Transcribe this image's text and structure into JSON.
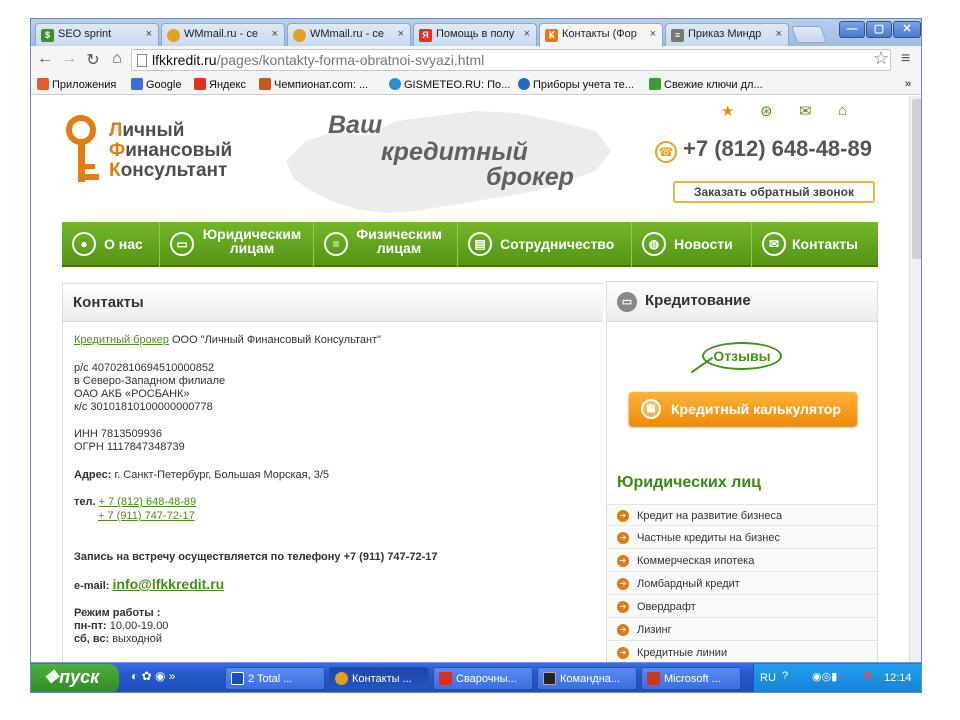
{
  "browser": {
    "tabs": [
      {
        "label": "SEO sprint",
        "icon": "dollar-icon",
        "color": "#3e8f2c",
        "active": false
      },
      {
        "label": "WMmail.ru - се",
        "icon": "coin-icon",
        "color": "#e5a220",
        "active": false
      },
      {
        "label": "WMmail.ru - се",
        "icon": "coin-icon",
        "color": "#e5a220",
        "active": false
      },
      {
        "label": "Помощь в полу",
        "icon": "yandex-icon",
        "color": "#e53020",
        "active": false
      },
      {
        "label": "Контакты (Фор",
        "icon": "key-icon",
        "color": "#e57c12",
        "active": true
      },
      {
        "label": "Приказ Миндр",
        "icon": "document-icon",
        "color": "#777777",
        "active": false
      }
    ],
    "tab_close": "×",
    "window_controls": {
      "minimize": "—",
      "maximize": "▢",
      "close": "✕"
    },
    "url": {
      "host": "lfkkredit.ru",
      "path": "/pages/kontakty-forma-obratnoi-svyazi.html"
    },
    "bookmarks": [
      {
        "label": "Приложения",
        "color": "#e35d2a"
      },
      {
        "label": "Google",
        "color": "#3b6fd6"
      },
      {
        "label": "Яндекс",
        "color": "#e53020"
      },
      {
        "label": "Чемпионат.com: ...",
        "color": "#c8571a"
      },
      {
        "label": "GISMETEO.RU: По...",
        "color": "#2d8fd3"
      },
      {
        "label": "Приборы учета те...",
        "color": "#1f6dbf"
      },
      {
        "label": "Свежие ключи дл...",
        "color": "#3a9d2e"
      }
    ],
    "bookmarks_more": "»"
  },
  "site": {
    "logo": {
      "line1_first": "Л",
      "line1_rest": "ичный",
      "line2_first": "Ф",
      "line2_rest": "инансовый",
      "line3_first": "К",
      "line3_rest": "онсультант"
    },
    "slogan": {
      "line1": "Ваш",
      "line2": "кредитный",
      "line3": "брокер"
    },
    "phone": "+7 (812) 648-48-89",
    "callback": "Заказать обратный звонок",
    "nav": [
      {
        "label": "О нас",
        "line2": ""
      },
      {
        "label": "Юридическим",
        "line2": "лицам"
      },
      {
        "label": "Физическим",
        "line2": "лицам"
      },
      {
        "label": "Сотрудничество",
        "line2": ""
      },
      {
        "label": "Новости",
        "line2": ""
      },
      {
        "label": "Контакты",
        "line2": ""
      }
    ],
    "contacts": {
      "heading": "Контакты",
      "broker_link": "Кредитный брокер",
      "broker_rest": " ООО \"Личный Финансовый Консультант\"",
      "account": "р/с 40702810694510000852",
      "branch": "в Северо-Западном филиале",
      "bank": "ОАО АКБ «РОСБАНК»",
      "corr": "к/с 30101810100000000778",
      "inn": "ИНН 7813509936",
      "ogrn": "ОГРН 1117847348739",
      "address_label": "Адрес:",
      "address": " г. Санкт-Петербург, Большая Морская, 3/5",
      "tel_label": "тел.",
      "tel1": "+ 7 (812) 648-48-89",
      "tel2": "+ 7 (911) 747-72-17",
      "appointment": "Запись на встречу осуществляется по телефону +7 (911) 747-72-17",
      "email_label": "e-mail:",
      "email": "info@lfkkredit.ru",
      "hours_label": "Режим работы :",
      "weekdays_label": "пн-пт:",
      "weekdays": " 10.00-19.00",
      "weekend_label": "сб, вс:",
      "weekend": " выходной"
    },
    "sidebar": {
      "heading": "Кредитование",
      "reviews": "Отзывы",
      "calculator": "Кредитный калькулятор",
      "section_title": "Юридических лиц",
      "items": [
        "Кредит на развитие бизнеса",
        "Частные кредиты на бизнес",
        "Коммерческая ипотека",
        "Ломбардный кредит",
        "Овердрафт",
        "Лизинг",
        "Кредитные линии"
      ]
    }
  },
  "taskbar": {
    "start": "пуск",
    "buttons": [
      {
        "label": "2 Total ...",
        "color": "#1b4fb8"
      },
      {
        "label": "Контакты ...",
        "color": "#e0a020"
      },
      {
        "label": "Сварочны...",
        "color": "#d83020"
      },
      {
        "label": "Командна...",
        "color": "#222222"
      },
      {
        "label": "Microsoft ...",
        "color": "#c83a20"
      }
    ],
    "lang": "RU",
    "clock": "12:14"
  },
  "colors": {
    "brand_green": "#559414",
    "brand_orange": "#e57c12",
    "link_green": "#4a8d16"
  }
}
